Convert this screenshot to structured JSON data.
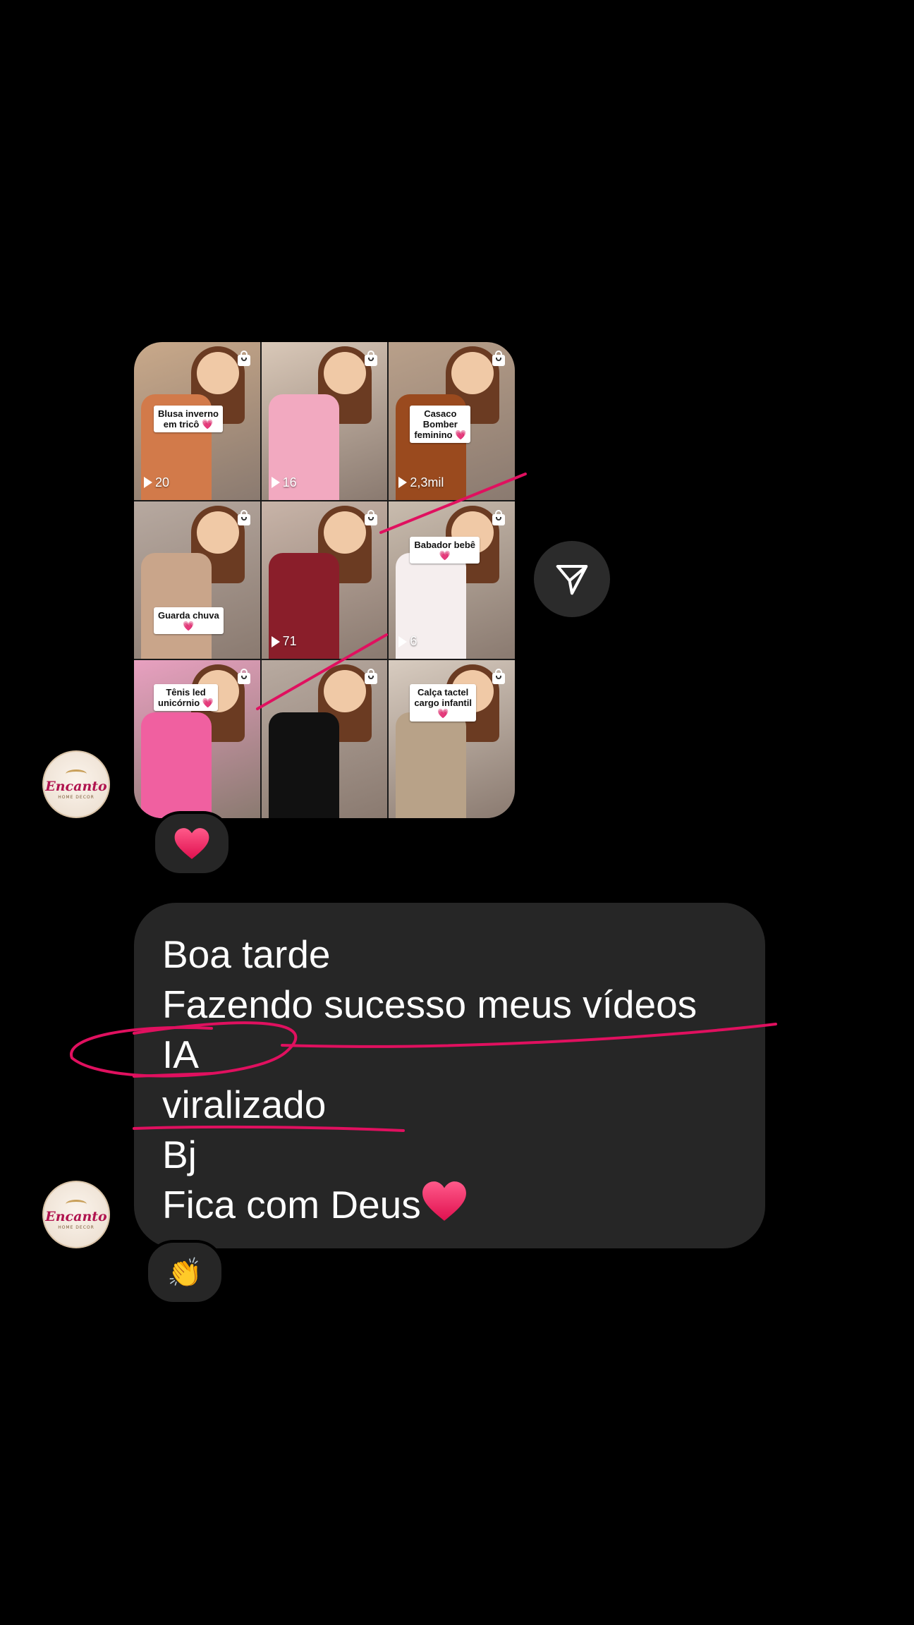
{
  "avatar": {
    "brand": "Encanto",
    "sub": "HOME DECOR"
  },
  "post": {
    "tiles": [
      {
        "tag": "Blusa inverno\nem tricô 💗",
        "views": "20",
        "bg": "#c9a98a",
        "garment": "#d27a4a"
      },
      {
        "tag": "",
        "views": "16",
        "bg": "#d9c8b8",
        "garment": "#f2a9c0"
      },
      {
        "tag": "Casaco\nBomber\nfeminino 💗",
        "views": "2,3mil",
        "bg": "#b9a08a",
        "garment": "#9a4a1e"
      },
      {
        "tag": "Guarda chuva\n💗",
        "views": "",
        "bg": "#b7a9a0",
        "garment": "#c9a58a"
      },
      {
        "tag": "",
        "views": "71",
        "bg": "#c8b4a8",
        "garment": "#8a1e2a"
      },
      {
        "tag": "Babador bebê\n💗",
        "views": "6",
        "bg": "#c9bcae",
        "garment": "#f5eeee"
      },
      {
        "tag": "Tênis led\nunicórnio 💗",
        "views": "",
        "bg": "#e8a0c0",
        "garment": "#f060a0"
      },
      {
        "tag": "",
        "views": "",
        "bg": "#b8aaa0",
        "garment": "#111111"
      },
      {
        "tag": "Calça tactel\ncargo infantil\n💗",
        "views": "",
        "bg": "#d8ccc0",
        "garment": "#b8a288"
      }
    ]
  },
  "reactions": {
    "first": "❤️",
    "second": "👏"
  },
  "message": {
    "lines": [
      "Boa tarde",
      "Fazendo sucesso meus vídeos",
      "IA",
      "viralizado",
      "Bj",
      "Fica com Deus"
    ]
  },
  "colors": {
    "background": "#000000",
    "bubble": "#262626",
    "annotation": "#e0105f"
  }
}
